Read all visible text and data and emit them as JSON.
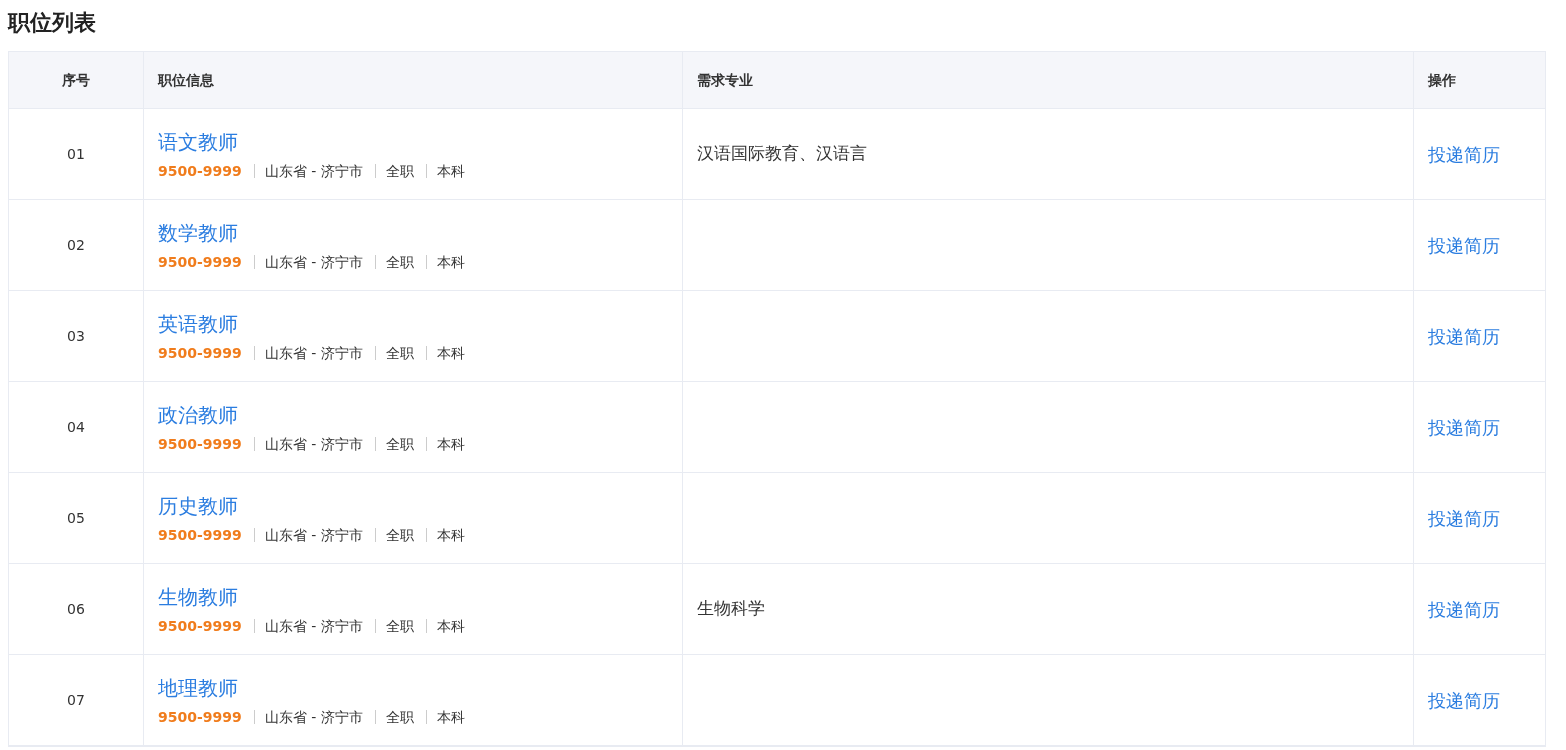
{
  "title": "职位列表",
  "table": {
    "columns": [
      "序号",
      "职位信息",
      "需求专业",
      "操作"
    ],
    "rows": [
      {
        "index": "01",
        "position": "语文教师",
        "salary": "9500-9999",
        "location": "山东省 - 济宁市",
        "type": "全职",
        "education": "本科",
        "major": "汉语国际教育、汉语言",
        "action": "投递简历"
      },
      {
        "index": "02",
        "position": "数学教师",
        "salary": "9500-9999",
        "location": "山东省 - 济宁市",
        "type": "全职",
        "education": "本科",
        "action": "投递简历"
      },
      {
        "index": "03",
        "position": "英语教师",
        "salary": "9500-9999",
        "location": "山东省 - 济宁市",
        "type": "全职",
        "education": "本科",
        "action": "投递简历"
      },
      {
        "index": "04",
        "position": "政治教师",
        "salary": "9500-9999",
        "location": "山东省 - 济宁市",
        "type": "全职",
        "education": "本科",
        "action": "投递简历"
      },
      {
        "index": "05",
        "position": "历史教师",
        "salary": "9500-9999",
        "location": "山东省 - 济宁市",
        "type": "全职",
        "education": "本科",
        "action": "投递简历"
      },
      {
        "index": "06",
        "position": "生物教师",
        "salary": "9500-9999",
        "location": "山东省 - 济宁市",
        "type": "全职",
        "education": "本科",
        "major": "生物科学",
        "action": "投递简历"
      },
      {
        "index": "07",
        "position": "地理教师",
        "salary": "9500-9999",
        "location": "山东省 - 济宁市",
        "type": "全职",
        "education": "本科",
        "action": "投递简历"
      }
    ]
  }
}
